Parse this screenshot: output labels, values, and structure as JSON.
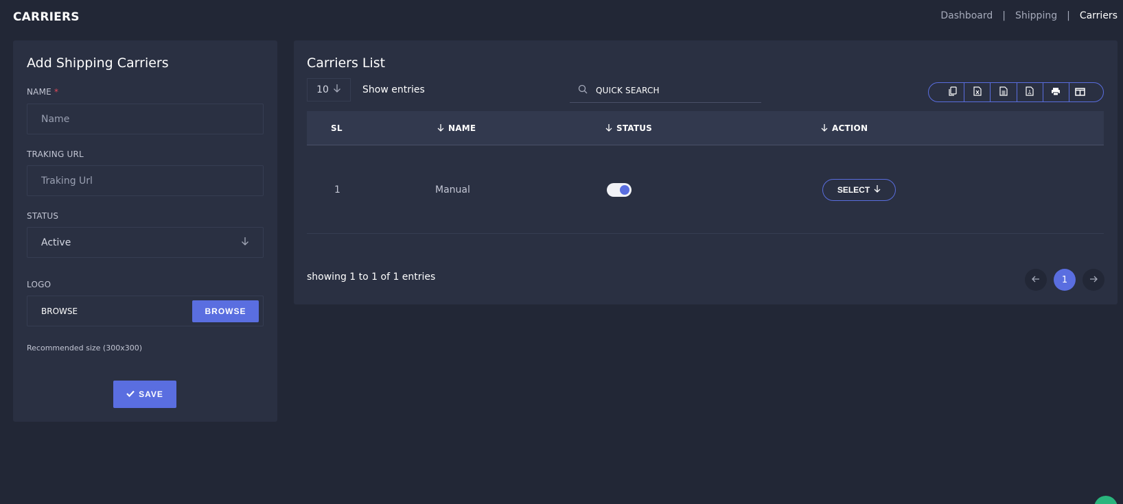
{
  "header": {
    "title": "CARRIERS",
    "breadcrumb": [
      "Dashboard",
      "Shipping",
      "Carriers"
    ],
    "separator": "|"
  },
  "form": {
    "title": "Add Shipping Carriers",
    "name_label": "NAME",
    "name_required": "*",
    "name_placeholder": "Name",
    "url_label": "TRAKING URL",
    "url_placeholder": "Traking Url",
    "status_label": "STATUS",
    "status_value": "Active",
    "logo_label": "LOGO",
    "logo_text": "BROWSE",
    "browse_button": "BROWSE",
    "hint": "Recommended size (300x300)",
    "save_button": "SAVE"
  },
  "list": {
    "title": "Carriers List",
    "entries_value": "10",
    "entries_label": "Show entries",
    "search_placeholder": "QUICK SEARCH",
    "toolbar_icons": [
      "copy-icon",
      "excel-icon",
      "csv-icon",
      "pdf-icon",
      "print-icon",
      "columns-icon"
    ],
    "columns": [
      "SL",
      "NAME",
      "STATUS",
      "ACTION"
    ],
    "rows": [
      {
        "sl": "1",
        "name": "Manual",
        "status": true,
        "action": "SELECT"
      }
    ],
    "footer": "showing 1 to 1 of 1 entries",
    "pages": [
      "1"
    ],
    "current_page": "1"
  },
  "colors": {
    "background": "#222736",
    "card": "#2a3042",
    "accent": "#5a6ee0",
    "required": "#e24a5a"
  }
}
